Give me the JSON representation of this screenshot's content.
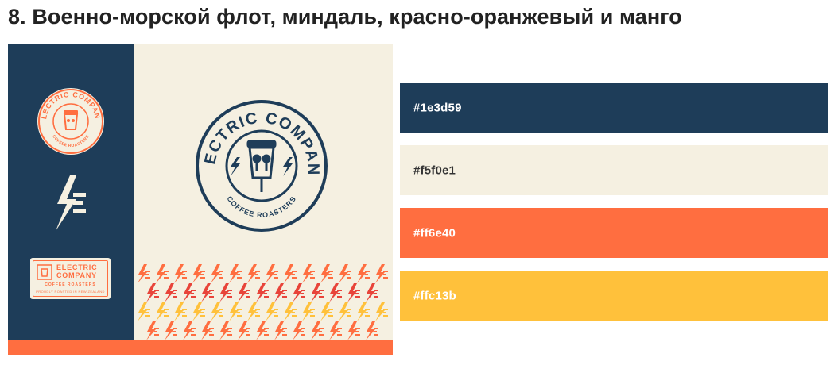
{
  "heading": "8. Военно-морской флот, миндаль, красно-оранжевый и манго",
  "brand": {
    "name_line1": "ELECTRIC",
    "name_line2": "COMPANY",
    "circle_text": "ELECTRIC COMPANY",
    "tagline": "COFFEE ROASTERS",
    "footnote": "PROUDLY ROASTED IN NEW ZEALAND"
  },
  "palette": [
    {
      "hex": "#1e3d59",
      "label": "#1e3d59",
      "text_color": "#ffffff"
    },
    {
      "hex": "#f5f0e1",
      "label": "#f5f0e1",
      "text_color": "#333333"
    },
    {
      "hex": "#ff6e40",
      "label": "#ff6e40",
      "text_color": "#ffffff"
    },
    {
      "hex": "#ffc13b",
      "label": "#ffc13b",
      "text_color": "#ffffff"
    }
  ]
}
